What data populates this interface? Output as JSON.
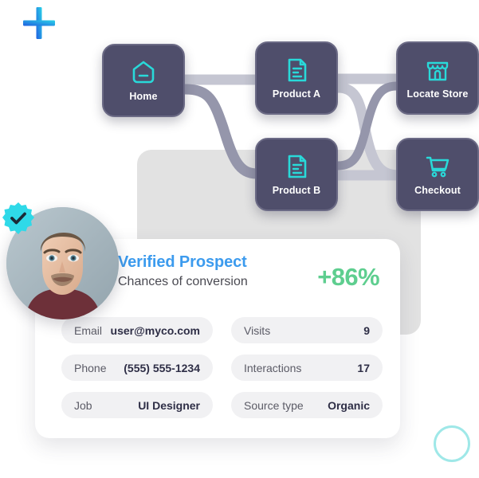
{
  "decor": {
    "plus_icon": "plus-icon",
    "plus_gradient_from": "#1f5fe0",
    "plus_gradient_to": "#2ad2e8",
    "ring_icon": "circle-outline-icon",
    "ring_color": "#9fe8e8"
  },
  "flow": {
    "node_bg": "#4f4e6b",
    "icon_color": "#29d9d9",
    "connector_light": "#c5c6d2",
    "connector_dark": "#9596ab",
    "nodes": [
      {
        "id": "home",
        "label": "Home",
        "icon": "home-icon"
      },
      {
        "id": "product-a",
        "label": "Product A",
        "icon": "document-icon"
      },
      {
        "id": "locate-store",
        "label": "Locate Store",
        "icon": "store-icon"
      },
      {
        "id": "product-b",
        "label": "Product B",
        "icon": "document-icon"
      },
      {
        "id": "checkout",
        "label": "Checkout",
        "icon": "cart-icon"
      }
    ]
  },
  "profile": {
    "avatar": "user-avatar",
    "verified_badge": "verified-check-icon",
    "badge_color": "#2fd9e8",
    "title": "Verified Prospect",
    "title_color": "#3c9bee",
    "subtitle": "Chances of conversion",
    "conversion": "+86%",
    "conversion_color": "#5ece8f",
    "details_left": [
      {
        "label": "Email",
        "value": "user@myco.com"
      },
      {
        "label": "Phone",
        "value": "(555) 555-1234"
      },
      {
        "label": "Job",
        "value": "UI Designer"
      }
    ],
    "details_right": [
      {
        "label": "Visits",
        "value": "9"
      },
      {
        "label": "Interactions",
        "value": "17"
      },
      {
        "label": "Source type",
        "value": "Organic"
      }
    ]
  }
}
